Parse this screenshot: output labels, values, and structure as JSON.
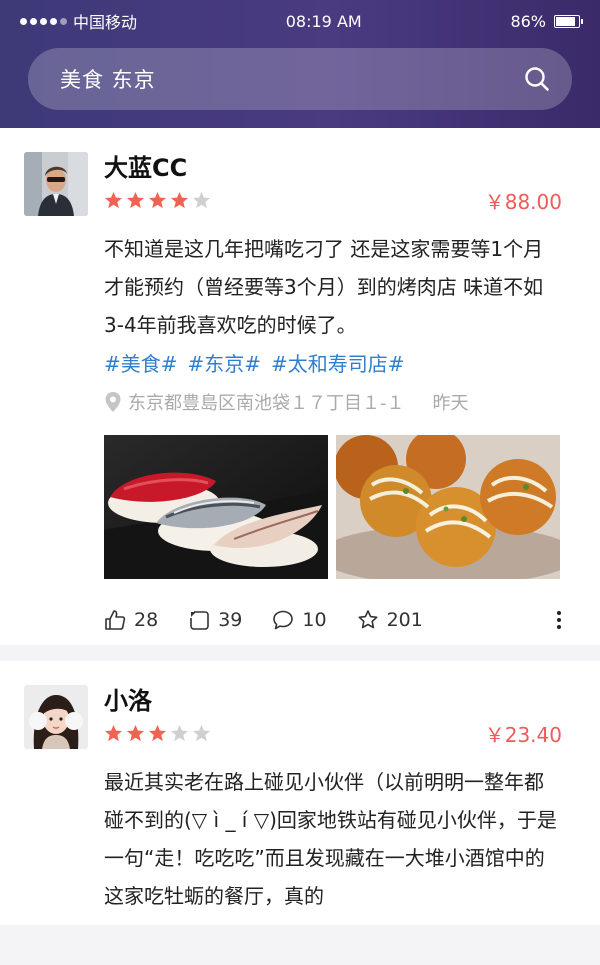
{
  "status": {
    "carrier": "中国移动",
    "time": "08:19 AM",
    "battery": "86%",
    "battery_level": 0.86
  },
  "search": {
    "query": "美食 东京"
  },
  "posts": [
    {
      "user": "大蓝CC",
      "rating": 4,
      "price": "￥88.00",
      "content": "不知道是这几年把嘴吃刁了 还是这家需要等1个月才能预约（曾经要等3个月）到的烤肉店 味道不如3-4年前我喜欢吃的时候了。",
      "tags": [
        "#美食#",
        "#东京#",
        "#太和寿司店#"
      ],
      "location": "东京都豊島区南池袋１７丁目１-１",
      "time": "昨天",
      "likes": "28",
      "reposts": "39",
      "comments": "10",
      "favorites": "201"
    },
    {
      "user": "小洛",
      "rating": 3,
      "price": "￥23.40",
      "content": "最近其实老在路上碰见小伙伴（以前明明一整年都碰不到的(▽ ì _ í ▽)回家地铁站有碰见小伙伴，于是一句“走！吃吃吃”而且发现藏在一大堆小酒馆中的这家吃牡蛎的餐厅，真的"
    }
  ]
}
